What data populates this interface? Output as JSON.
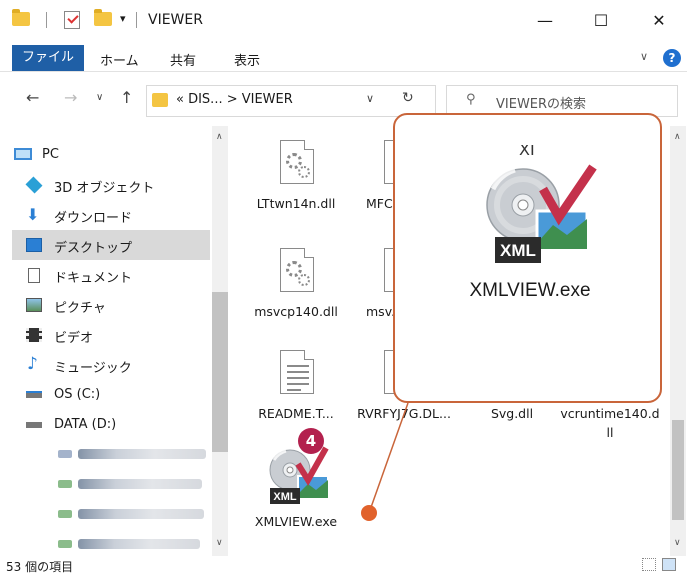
{
  "window": {
    "title": "VIEWER",
    "minimize": "—",
    "maximize": "☐",
    "close": "✕"
  },
  "ribbon": {
    "file": "ファイル",
    "tabs": [
      "ホーム",
      "共有",
      "表示"
    ],
    "help": "?"
  },
  "address": {
    "path": "« DIS... > VIEWER",
    "search_placeholder": "VIEWERの検索"
  },
  "sidebar": {
    "items": [
      {
        "label": "PC",
        "icon": "pc-icon"
      },
      {
        "label": "3D オブジェクト",
        "icon": "3d-objects-icon"
      },
      {
        "label": "ダウンロード",
        "icon": "download-icon"
      },
      {
        "label": "デスクトップ",
        "icon": "desktop-icon",
        "selected": true
      },
      {
        "label": "ドキュメント",
        "icon": "documents-icon"
      },
      {
        "label": "ピクチャ",
        "icon": "pictures-icon"
      },
      {
        "label": "ビデオ",
        "icon": "videos-icon"
      },
      {
        "label": "ミュージック",
        "icon": "music-icon"
      },
      {
        "label": "OS (C:)",
        "icon": "drive-c-icon"
      },
      {
        "label": "DATA (D:)",
        "icon": "drive-d-icon"
      }
    ]
  },
  "files": [
    {
      "name": "LTtwn14n.dll",
      "type": "dll"
    },
    {
      "name": "MFC...",
      "type": "dll"
    },
    {
      "name": "msvcp140.dll",
      "type": "dll"
    },
    {
      "name": "msv...",
      "type": "dll"
    },
    {
      "name": "README.T...",
      "type": "txt"
    },
    {
      "name": "RVRFYJ7G.DL...",
      "type": "dll"
    },
    {
      "name": "Svg.dll",
      "type": "dll"
    },
    {
      "name": "vcruntime140.dll",
      "type": "dll"
    },
    {
      "name": "XMLVIEW.exe",
      "type": "exe"
    }
  ],
  "callout": {
    "file_name": "XMLVIEW.exe",
    "top_partial": "XI",
    "badge_text": "XML"
  },
  "step_badge": "4",
  "status": {
    "item_count": "53 個の項目"
  },
  "colors": {
    "accent_blue": "#1f5fa6",
    "callout_border": "#c9653a",
    "badge": "#b3214e",
    "checkmark": "#c4314b"
  }
}
